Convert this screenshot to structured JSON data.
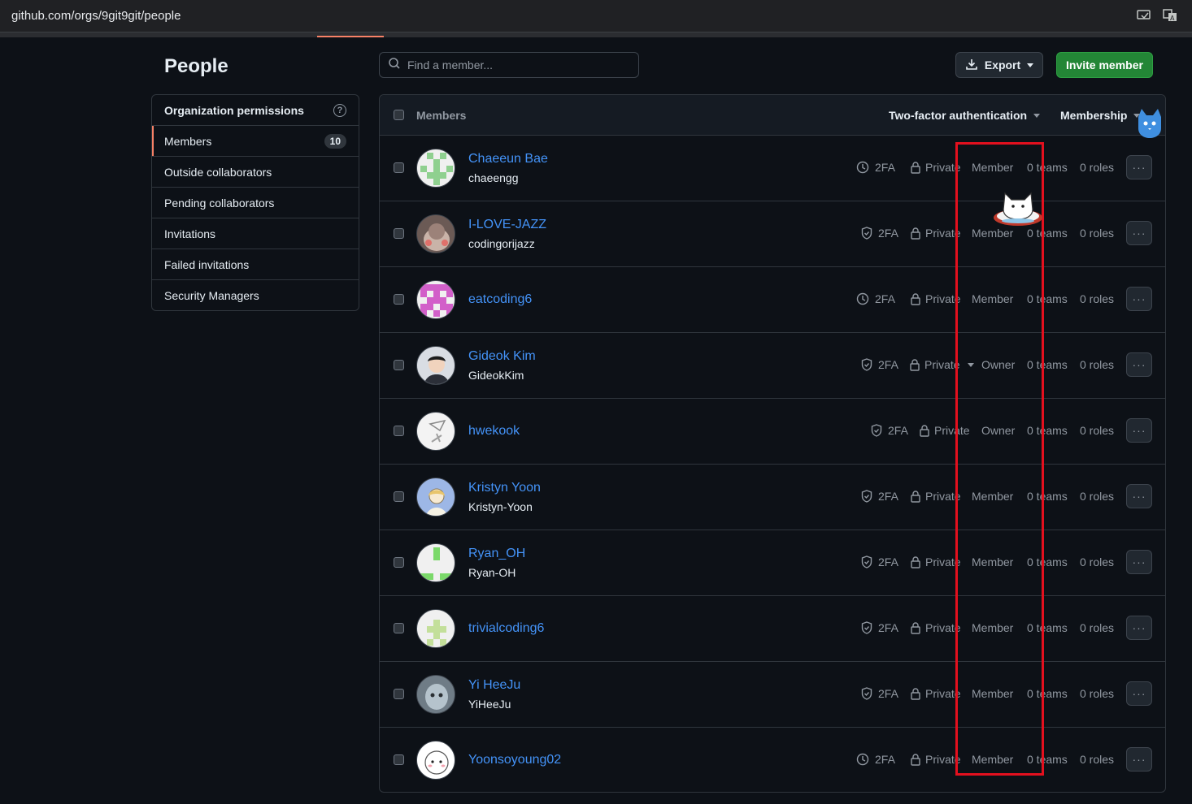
{
  "browser": {
    "url": "github.com/orgs/9git9git/people"
  },
  "page": {
    "title": "People"
  },
  "sidebar": {
    "header": "Organization permissions",
    "items": [
      {
        "label": "Members",
        "count": "10",
        "active": true
      },
      {
        "label": "Outside collaborators"
      },
      {
        "label": "Pending collaborators"
      },
      {
        "label": "Invitations"
      },
      {
        "label": "Failed invitations"
      },
      {
        "label": "Security Managers"
      }
    ]
  },
  "search": {
    "placeholder": "Find a member..."
  },
  "toolbar": {
    "export_label": "Export",
    "invite_label": "Invite member"
  },
  "table": {
    "header": {
      "members_label": "Members",
      "tfa_filter": "Two-factor authentication",
      "membership_filter": "Membership"
    },
    "rows": [
      {
        "name": "Chaeeun Bae",
        "login": "chaeengg",
        "tfa": "2FA",
        "tfa_icon": "clock-icon",
        "visibility": "Private",
        "role": "Member",
        "teams": "0 teams",
        "roles": "0 roles"
      },
      {
        "name": "I-LOVE-JAZZ",
        "login": "codingorijazz",
        "tfa": "2FA",
        "tfa_icon": "shield-check-icon",
        "visibility": "Private",
        "role": "Member",
        "teams": "0 teams",
        "roles": "0 roles"
      },
      {
        "name": "eatcoding6",
        "login": "",
        "tfa": "2FA",
        "tfa_icon": "clock-icon",
        "visibility": "Private",
        "role": "Member",
        "teams": "0 teams",
        "roles": "0 roles"
      },
      {
        "name": "Gideok Kim",
        "login": "GideokKim",
        "tfa": "2FA",
        "tfa_icon": "shield-check-icon",
        "visibility": "Private",
        "role": "Owner",
        "teams": "0 teams",
        "roles": "0 roles"
      },
      {
        "name": "hwekook",
        "login": "",
        "tfa": "2FA",
        "tfa_icon": "shield-check-icon",
        "visibility": "Private",
        "role": "Owner",
        "teams": "0 teams",
        "roles": "0 roles"
      },
      {
        "name": "Kristyn Yoon",
        "login": "Kristyn-Yoon",
        "tfa": "2FA",
        "tfa_icon": "shield-check-icon",
        "visibility": "Private",
        "role": "Member",
        "teams": "0 teams",
        "roles": "0 roles"
      },
      {
        "name": "Ryan_OH",
        "login": "Ryan-OH",
        "tfa": "2FA",
        "tfa_icon": "shield-check-icon",
        "visibility": "Private",
        "role": "Member",
        "teams": "0 teams",
        "roles": "0 roles"
      },
      {
        "name": "trivialcoding6",
        "login": "",
        "tfa": "2FA",
        "tfa_icon": "shield-check-icon",
        "visibility": "Private",
        "role": "Member",
        "teams": "0 teams",
        "roles": "0 roles"
      },
      {
        "name": "Yi HeeJu",
        "login": "YiHeeJu",
        "tfa": "2FA",
        "tfa_icon": "shield-check-icon",
        "visibility": "Private",
        "role": "Member",
        "teams": "0 teams",
        "roles": "0 roles"
      },
      {
        "name": "Yoonsoyoung02",
        "login": "",
        "tfa": "2FA",
        "tfa_icon": "clock-icon",
        "visibility": "Private",
        "role": "Member",
        "teams": "0 teams",
        "roles": "0 roles"
      }
    ]
  },
  "colors": {
    "accent_tab": "#f78166",
    "link": "#4493f8",
    "invite_green": "#238636",
    "highlight_red": "#e3101e"
  }
}
